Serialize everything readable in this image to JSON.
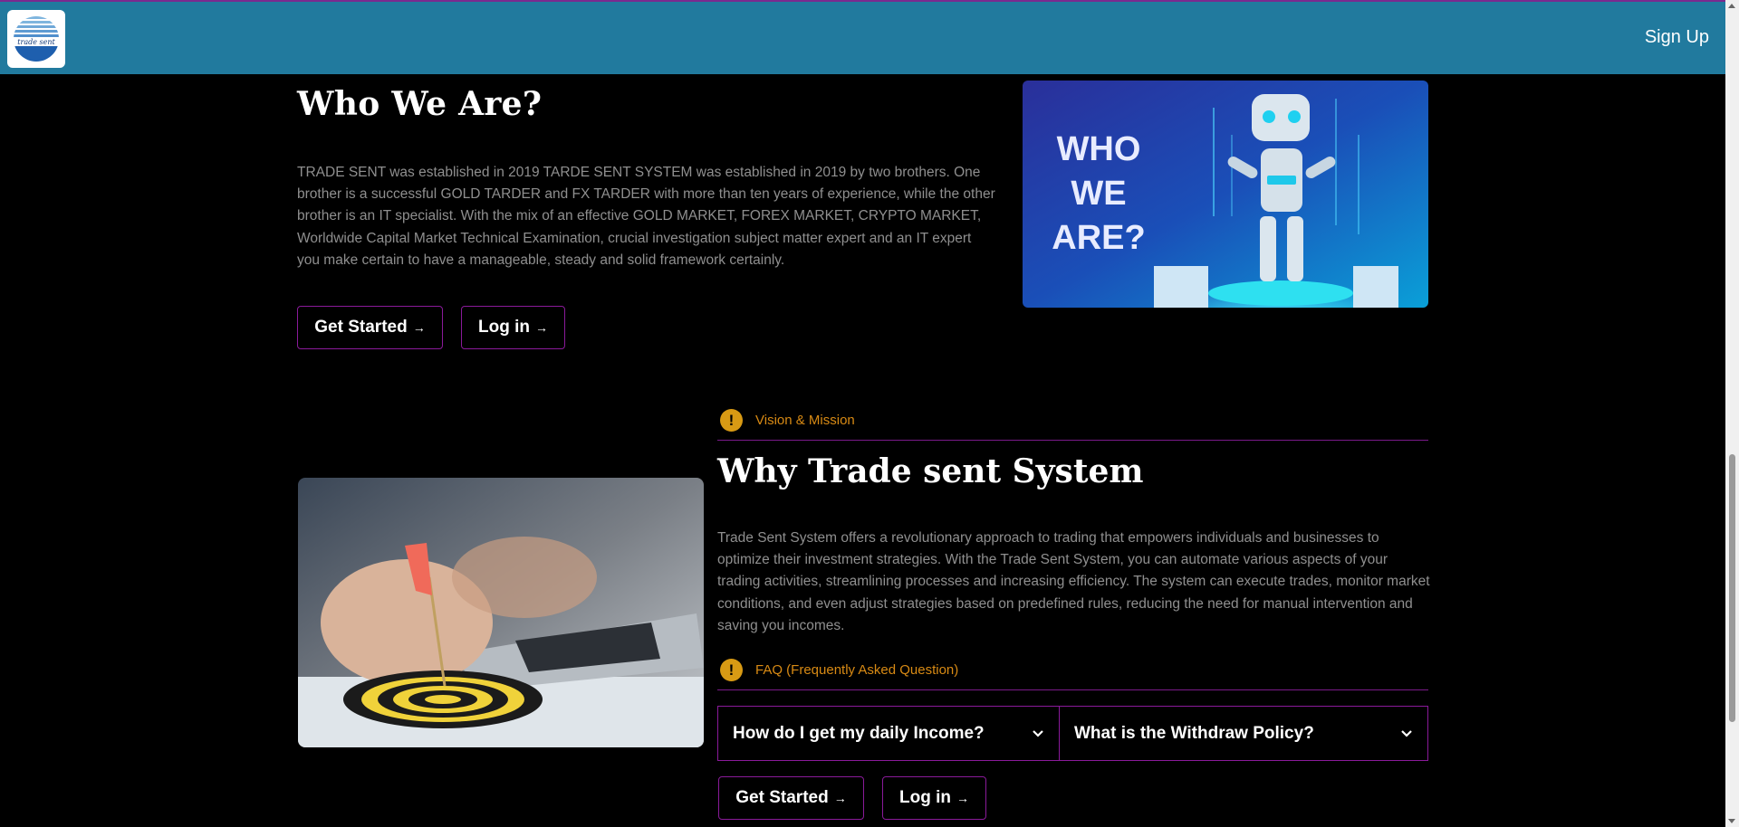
{
  "header": {
    "logo_text": "trade sent",
    "signup_label": "Sign Up"
  },
  "who": {
    "title": "Who We Are?",
    "body": "TRADE SENT was established in 2019 TARDE SENT SYSTEM was established in 2019 by two brothers. One brother is a successful GOLD TARDER and FX TARDER with more than ten years of experience, while the other brother is an IT specialist. With the mix of an effective GOLD MARKET, FOREX MARKET, CRYPTO MARKET, Worldwide Capital Market Technical Examination, crucial investigation subject matter expert and an IT expert you make certain to have a manageable, steady and solid framework certainly.",
    "get_started": "Get Started",
    "login": "Log in",
    "image_text": [
      "WHO",
      "WE",
      "ARE?"
    ]
  },
  "vision": {
    "tag": "Vision & Mission",
    "title": "Why Trade sent System",
    "body": "Trade Sent System offers a revolutionary approach to trading that empowers individuals and businesses to optimize their investment strategies. With the Trade Sent System, you can automate various aspects of your trading activities, streamlining processes and increasing efficiency. The system can execute trades, monitor market conditions, and even adjust strategies based on predefined rules, reducing the need for manual intervention and saving you incomes."
  },
  "faq": {
    "tag": "FAQ (Frequently Asked Question)",
    "items": [
      {
        "question": "How do I get my daily Income?"
      },
      {
        "question": "What is the Withdraw Policy?"
      }
    ],
    "get_started": "Get Started",
    "login": "Log in"
  },
  "colors": {
    "header_bg": "#217a9e",
    "accent_border": "#8a1a9a",
    "tag_orange": "#d88a14"
  }
}
